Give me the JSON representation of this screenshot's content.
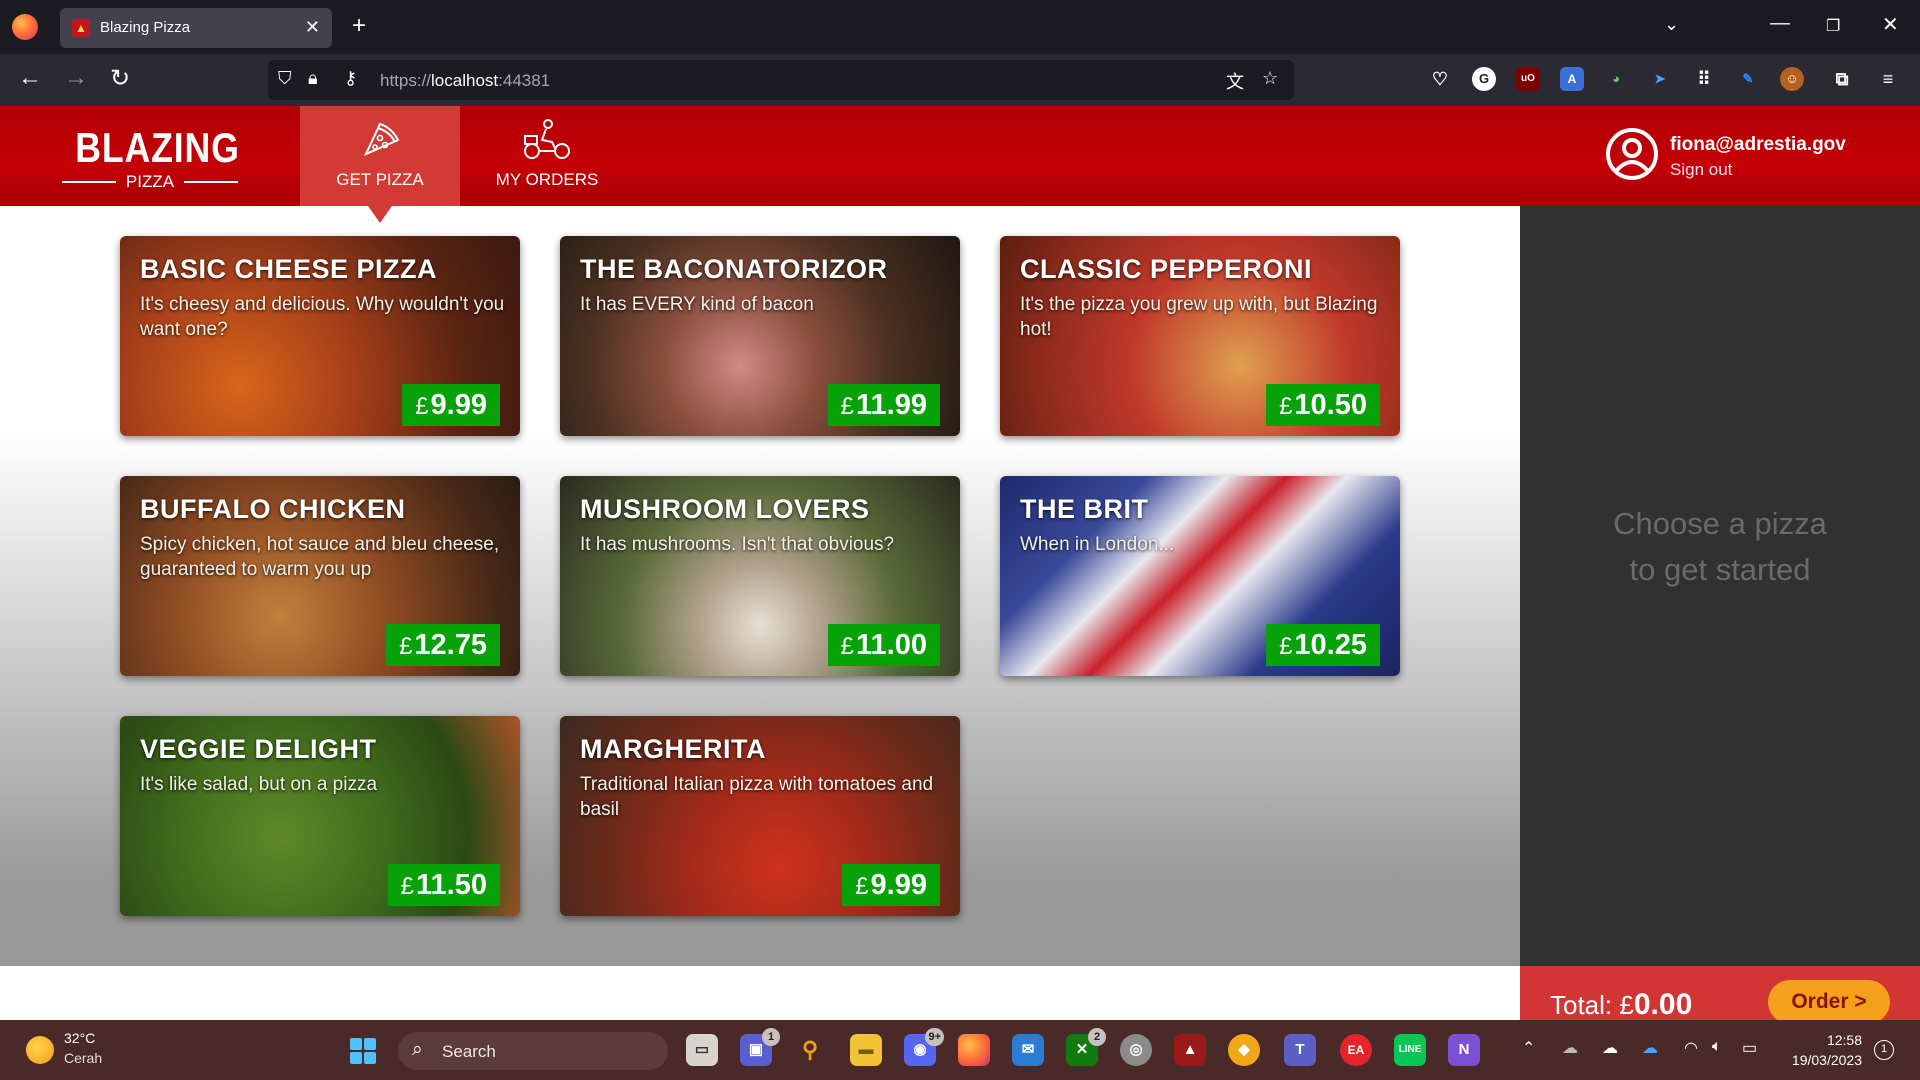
{
  "browser": {
    "tab_title": "Blazing Pizza",
    "url_scheme": "https://",
    "url_host": "localhost",
    "url_port": ":44381"
  },
  "header": {
    "logo_main": "BLAZING",
    "logo_sub": "PIZZA",
    "nav": [
      {
        "label": "GET PIZZA",
        "active": true
      },
      {
        "label": "MY ORDERS",
        "active": false
      }
    ],
    "user_email": "fiona@adrestia.gov",
    "sign_out": "Sign out"
  },
  "pizzas": [
    {
      "name": "BASIC CHEESE PIZZA",
      "description": "It's cheesy and delicious. Why wouldn't you want one?",
      "currency": "£",
      "price": "9.99"
    },
    {
      "name": "THE BACONATORIZOR",
      "description": "It has EVERY kind of bacon",
      "currency": "£",
      "price": "11.99"
    },
    {
      "name": "CLASSIC PEPPERONI",
      "description": "It's the pizza you grew up with, but Blazing hot!",
      "currency": "£",
      "price": "10.50"
    },
    {
      "name": "BUFFALO CHICKEN",
      "description": "Spicy chicken, hot sauce and bleu cheese, guaranteed to warm you up",
      "currency": "£",
      "price": "12.75"
    },
    {
      "name": "MUSHROOM LOVERS",
      "description": "It has mushrooms. Isn't that obvious?",
      "currency": "£",
      "price": "11.00"
    },
    {
      "name": "THE BRIT",
      "description": "When in London...",
      "currency": "£",
      "price": "10.25"
    },
    {
      "name": "VEGGIE DELIGHT",
      "description": "It's like salad, but on a pizza",
      "currency": "£",
      "price": "11.50"
    },
    {
      "name": "MARGHERITA",
      "description": "Traditional Italian pizza with tomatoes and basil",
      "currency": "£",
      "price": "9.99"
    }
  ],
  "sidebar": {
    "empty_line1": "Choose a pizza",
    "empty_line2": "to get started",
    "total_label": "Total:",
    "total_currency": "£",
    "total_value": "0.00",
    "order_button": "Order >"
  },
  "taskbar": {
    "temperature": "32°C",
    "condition": "Cerah",
    "search": "Search",
    "time": "12:58",
    "date": "19/03/2023",
    "badges": {
      "teams": "1",
      "discord": "9+",
      "xbox": "2"
    },
    "notifications": "1"
  },
  "colors": {
    "brand_red": "#c40107",
    "active_tab": "#d23b35",
    "price_green": "#07a10a",
    "order_orange": "#f5a01c"
  }
}
